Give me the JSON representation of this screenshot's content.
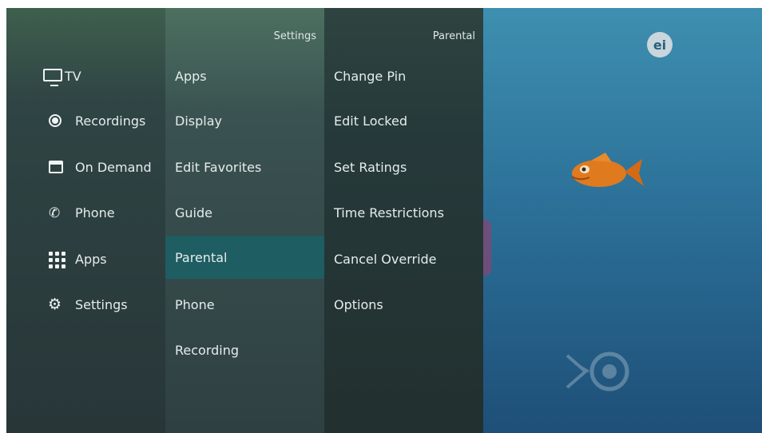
{
  "main_menu": {
    "items": [
      {
        "label": "TV",
        "icon": "tv-icon"
      },
      {
        "label": "Recordings",
        "icon": "record-icon"
      },
      {
        "label": "On Demand",
        "icon": "on-demand-icon"
      },
      {
        "label": "Phone",
        "icon": "phone-icon"
      },
      {
        "label": "Apps",
        "icon": "apps-grid-icon"
      },
      {
        "label": "Settings",
        "icon": "gear-icon"
      }
    ]
  },
  "settings_menu": {
    "header": "Settings",
    "items": [
      {
        "label": "Apps"
      },
      {
        "label": "Display"
      },
      {
        "label": "Edit Favorites"
      },
      {
        "label": "Guide"
      },
      {
        "label": "Parental",
        "selected": true
      },
      {
        "label": "Phone"
      },
      {
        "label": "Recording"
      }
    ]
  },
  "parental_menu": {
    "header": "Parental",
    "items": [
      {
        "label": "Change Pin"
      },
      {
        "label": "Edit Locked"
      },
      {
        "label": "Set Ratings"
      },
      {
        "label": "Time Restrictions"
      },
      {
        "label": "Cancel Override"
      },
      {
        "label": "Options"
      }
    ]
  },
  "video": {
    "logo_text": "ei",
    "icons": [
      "ei-logo",
      "fish-character",
      "pbs-watermark-icon"
    ]
  },
  "colors": {
    "selection": "#1e5d62",
    "text": "#e6ecec",
    "water": "#2c7199"
  }
}
